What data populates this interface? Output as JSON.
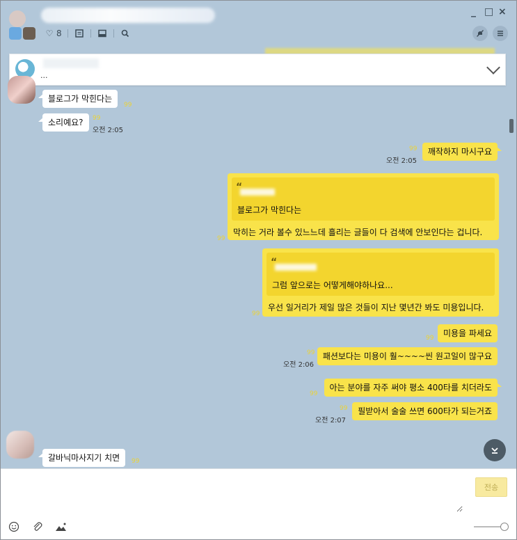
{
  "titlebar": {
    "like_count": "8",
    "controls": {
      "minimize": "_",
      "maximize": "□",
      "close": "×"
    }
  },
  "notice": {
    "text": "..."
  },
  "messages": {
    "m1": {
      "text": "블로그가 막힌다는",
      "unread": "99"
    },
    "m2": {
      "text": "소리예요?",
      "unread": "99",
      "time": "오전 2:05"
    },
    "m3": {
      "text": "깨작하지 마시구요",
      "unread": "99",
      "time": "오전 2:05"
    },
    "q1": {
      "quoted": "블로그가 막힌다는",
      "reply": "막히는 거라 볼수 있느느데 흘리는 글들이 다 검색에 안보인다는 겁니다.",
      "unread": "99"
    },
    "q2": {
      "quoted": "그럼 앞으로는 어떻게해야하나요...",
      "reply": "우선 일거리가 제일 많은 것들이 지난 몇년간 봐도 미용입니다.",
      "unread": "99"
    },
    "m4": {
      "text": "미용을 파세요",
      "unread": "99"
    },
    "m5": {
      "text": "패션보다는 미용이 훨~~~~씬 원고일이 많구요",
      "unread": "99",
      "time": "오전 2:06"
    },
    "m6": {
      "text": "아는 분야를 자주 써야 평소 400타를 치더라도",
      "unread": "99"
    },
    "m7": {
      "text": "필받아서 술술 쓰면 600타가 되는거죠",
      "unread": "99",
      "time": "오전 2:07"
    },
    "m8": {
      "text": "갈바닉마사지기 치면",
      "unread": "99"
    }
  },
  "input": {
    "send_label": "전송",
    "placeholder": ""
  },
  "icons": {
    "heart": "heart-icon",
    "notes": "notes-icon",
    "inbox": "inbox-icon",
    "search": "search-icon",
    "mute": "mute-icon",
    "menu": "menu-icon",
    "emoji": "emoji-icon",
    "attach": "attach-icon",
    "image": "image-icon"
  },
  "colors": {
    "chat_bg": "#b2c7d9",
    "my_bubble": "#f9e34a",
    "unread": "#e9d23a"
  }
}
